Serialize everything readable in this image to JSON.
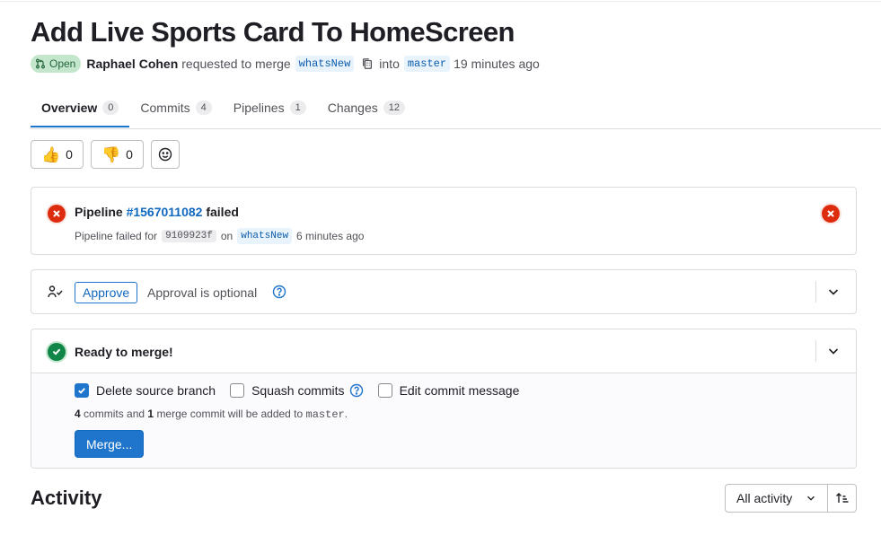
{
  "mr": {
    "title": "Add Live Sports Card To HomeScreen",
    "status": "Open",
    "author": "Raphael Cohen",
    "requested_text": "requested to merge",
    "source_branch": "whatsNew",
    "into_text": "into",
    "target_branch": "master",
    "time_ago": "19 minutes ago"
  },
  "tabs": [
    {
      "label": "Overview",
      "count": "0"
    },
    {
      "label": "Commits",
      "count": "4"
    },
    {
      "label": "Pipelines",
      "count": "1"
    },
    {
      "label": "Changes",
      "count": "12"
    }
  ],
  "reactions": {
    "thumbs_up": {
      "icon": "thumbs-up-icon",
      "count": "0"
    },
    "thumbs_down": {
      "icon": "thumbs-down-icon",
      "count": "0"
    }
  },
  "pipeline": {
    "prefix": "Pipeline",
    "id": "#1567011082",
    "suffix": "failed",
    "sub_prefix": "Pipeline failed for",
    "sha": "9109923f",
    "on_text": "on",
    "branch": "whatsNew",
    "time": "6 minutes ago"
  },
  "approval": {
    "button": "Approve",
    "text": "Approval is optional"
  },
  "merge": {
    "title": "Ready to merge!",
    "delete_source_label": "Delete source branch",
    "delete_source_checked": true,
    "squash_label": "Squash commits",
    "squash_checked": false,
    "edit_msg_label": "Edit commit message",
    "edit_msg_checked": false,
    "commits_count": "4",
    "commits_text": "commits and",
    "merge_commit_count": "1",
    "merge_commit_text": "merge commit will be added to",
    "target": "master",
    "period": ".",
    "button": "Merge..."
  },
  "activity": {
    "title": "Activity",
    "filter": "All activity"
  },
  "colors": {
    "accent": "#1f75cb",
    "failed": "#dd2b0e",
    "success": "#108548"
  }
}
